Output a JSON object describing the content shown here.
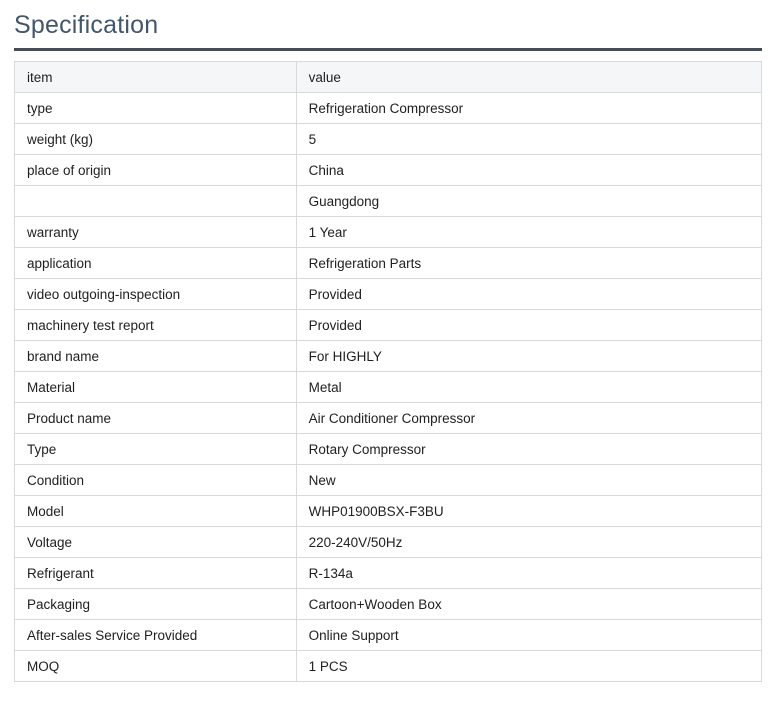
{
  "page": {
    "title": "Specification"
  },
  "table": {
    "headers": {
      "item": "item",
      "value": "value"
    },
    "rows": [
      {
        "item": "type",
        "value": "Refrigeration Compressor"
      },
      {
        "item": "weight (kg)",
        "value": "5"
      },
      {
        "item": "place of origin",
        "value": "China"
      },
      {
        "item": "",
        "value": "Guangdong"
      },
      {
        "item": "warranty",
        "value": "1 Year"
      },
      {
        "item": "application",
        "value": "Refrigeration Parts"
      },
      {
        "item": "video outgoing-inspection",
        "value": "Provided"
      },
      {
        "item": "machinery test report",
        "value": "Provided"
      },
      {
        "item": "brand name",
        "value": "For HIGHLY"
      },
      {
        "item": "Material",
        "value": "Metal"
      },
      {
        "item": "Product name",
        "value": "Air Conditioner Compressor"
      },
      {
        "item": "Type",
        "value": "Rotary Compressor"
      },
      {
        "item": "Condition",
        "value": "New"
      },
      {
        "item": "Model",
        "value": "WHP01900BSX-F3BU"
      },
      {
        "item": "Voltage",
        "value": "220-240V/50Hz"
      },
      {
        "item": "Refrigerant",
        "value": "R-134a"
      },
      {
        "item": "Packaging",
        "value": "Cartoon+Wooden Box"
      },
      {
        "item": "After-sales Service Provided",
        "value": "Online Support"
      },
      {
        "item": "MOQ",
        "value": "1 PCS"
      }
    ]
  },
  "colors": {
    "title_text": "#44566c",
    "divider": "#454e59",
    "table_border": "#d9d9d9",
    "header_bg": "#f5f6f8",
    "body_text": "#212121"
  }
}
